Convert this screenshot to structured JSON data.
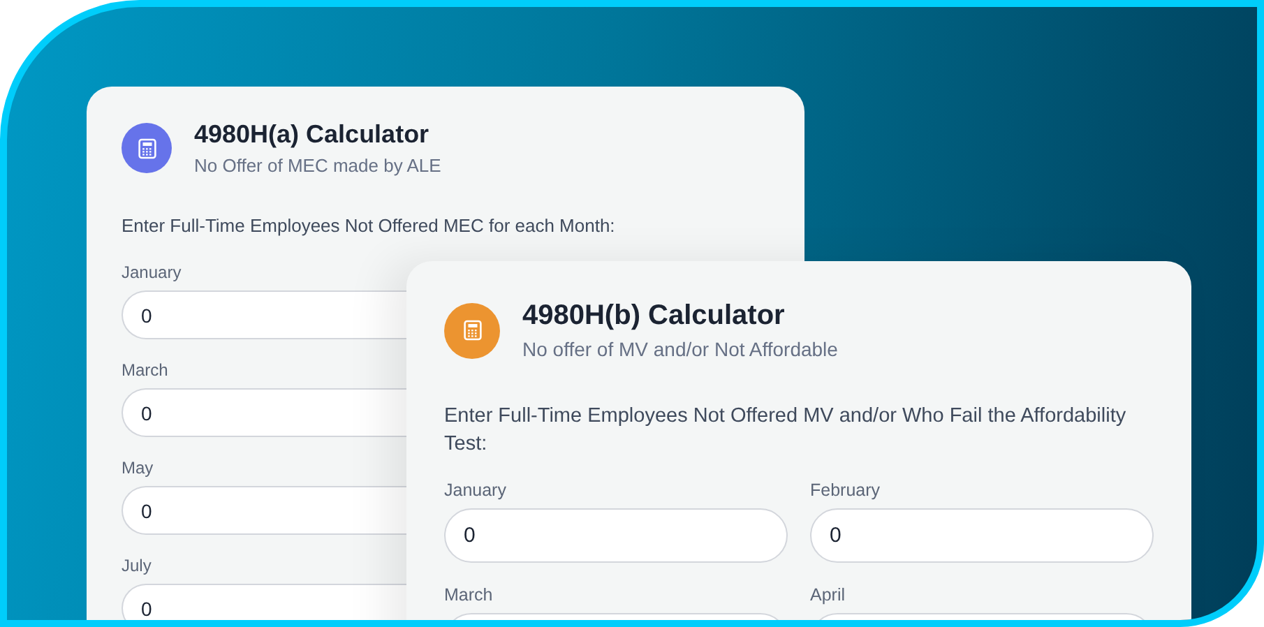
{
  "cards": [
    {
      "title": "4980H(a) Calculator",
      "subtitle": "No Offer of MEC made by ALE",
      "color": "#6673ea",
      "instruction": "Enter Full-Time Employees Not Offered MEC for each Month:",
      "fields": [
        {
          "label": "January",
          "value": "0"
        },
        {
          "label": "March",
          "value": "0"
        },
        {
          "label": "May",
          "value": "0"
        },
        {
          "label": "July",
          "value": "0"
        }
      ]
    },
    {
      "title": "4980H(b) Calculator",
      "subtitle": "No offer of MV and/or Not Affordable",
      "color": "#ec9430",
      "instruction": "Enter Full-Time Employees Not Offered MV and/or Who Fail the Affordability Test:",
      "fields": [
        {
          "label": "January",
          "value": "0"
        },
        {
          "label": "February",
          "value": "0"
        },
        {
          "label": "March"
        },
        {
          "label": "April"
        }
      ]
    }
  ]
}
